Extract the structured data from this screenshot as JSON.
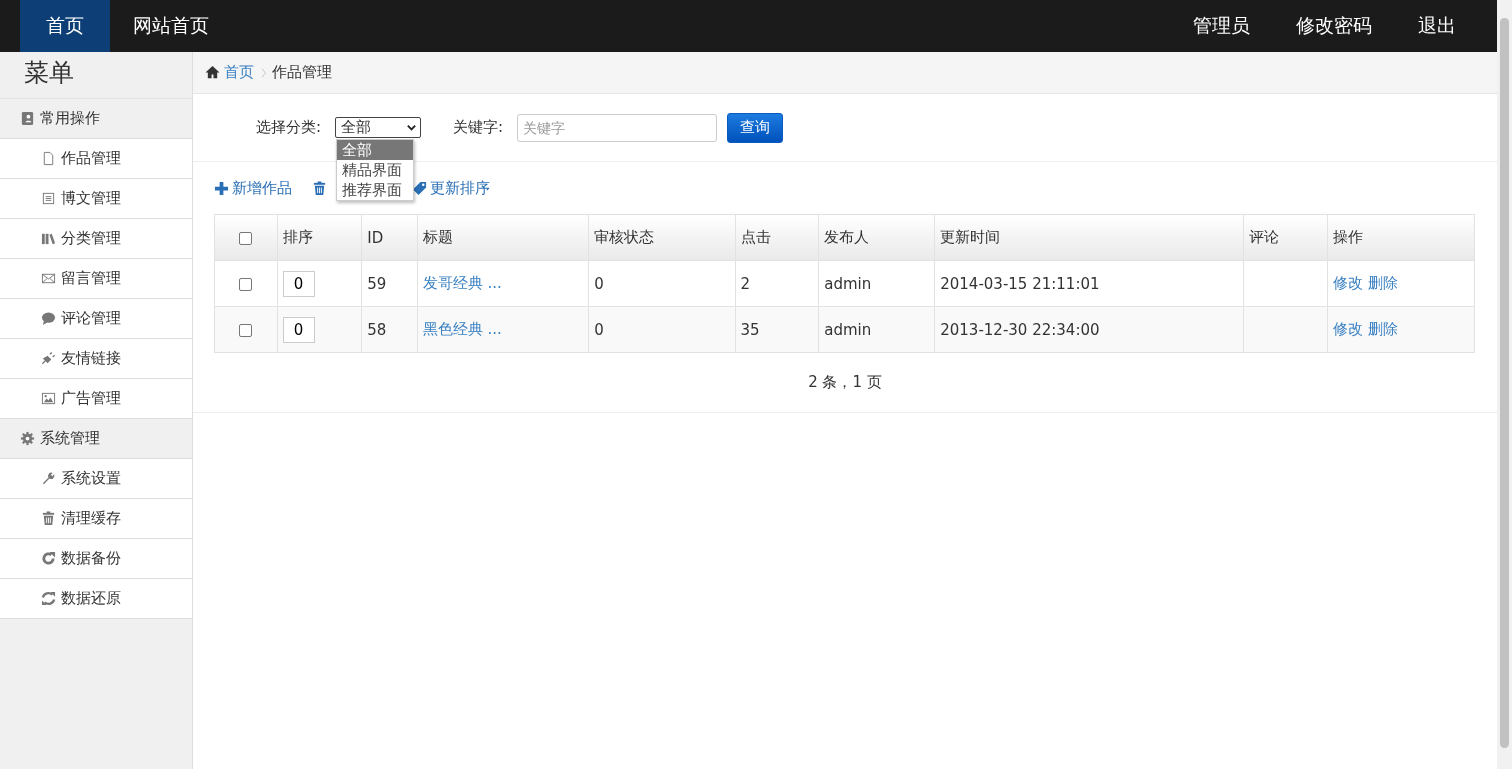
{
  "topbar": {
    "left": [
      {
        "label": "首页",
        "selected": true
      },
      {
        "label": "网站首页",
        "selected": false
      }
    ],
    "right": [
      "管理员",
      "修改密码",
      "退出"
    ]
  },
  "sidebar": {
    "title": "菜单",
    "groups": [
      {
        "label": "常用操作",
        "items": [
          "作品管理",
          "博文管理",
          "分类管理",
          "留言管理",
          "评论管理",
          "友情链接",
          "广告管理"
        ]
      },
      {
        "label": "系统管理",
        "items": [
          "系统设置",
          "清理缓存",
          "数据备份",
          "数据还原"
        ]
      }
    ]
  },
  "breadcrumb": {
    "home": "首页",
    "current": "作品管理"
  },
  "filter": {
    "category": {
      "label": "选择分类:",
      "value": "全部",
      "open": true,
      "options": [
        {
          "label": "全部",
          "selected": true
        },
        {
          "label": "精品界面",
          "selected": false
        },
        {
          "label": "推荐界面",
          "selected": false
        }
      ]
    },
    "keyword": {
      "label": "关键字:",
      "placeholder": "关键字"
    },
    "button": "查询"
  },
  "toolbar": [
    {
      "kind": "add",
      "label": "新增作品"
    },
    {
      "kind": "delete"
    },
    {
      "kind": "sort",
      "label": "更新排序"
    }
  ],
  "table": {
    "select_all": {
      "checked": false
    },
    "columns": [
      "排序",
      "ID",
      "标题",
      "审核状态",
      "点击",
      "发布人",
      "更新时间",
      "评论",
      "操作"
    ],
    "rows": [
      {
        "checked": false,
        "order": "0",
        "id": "59",
        "title": "发哥经典 ...",
        "status": "0",
        "clicks": "2",
        "author": "admin",
        "updated": "2014-03-15 21:11:01",
        "actions": [
          "修改",
          "删除"
        ]
      },
      {
        "checked": false,
        "order": "0",
        "id": "58",
        "title": "黑色经典 ...",
        "status": "0",
        "clicks": "35",
        "author": "admin",
        "updated": "2013-12-30 22:34:00",
        "actions": [
          "修改",
          "删除"
        ]
      }
    ]
  },
  "pagination": "2 条，1 页"
}
